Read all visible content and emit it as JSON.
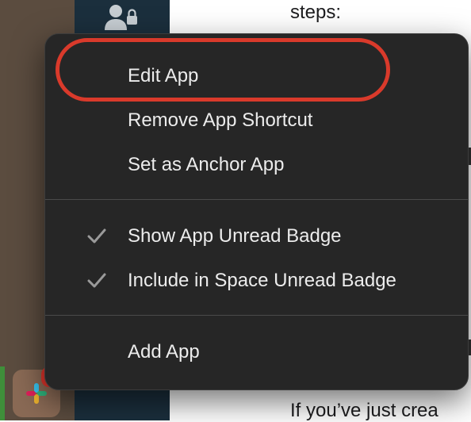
{
  "content": {
    "top_text": "steps:",
    "bottom_text": "If you’ve just crea"
  },
  "menu": {
    "items": [
      {
        "label": "Edit App",
        "checked": false
      },
      {
        "label": "Remove App Shortcut",
        "checked": false
      },
      {
        "label": "Set as Anchor App",
        "checked": false
      },
      {
        "label": "Show App Unread Badge",
        "checked": true
      },
      {
        "label": "Include in Space Unread Badge",
        "checked": true
      },
      {
        "label": "Add App",
        "checked": false
      }
    ]
  },
  "icons": {
    "rail": "user-lock-icon",
    "app": "slack-icon",
    "check": "checkmark-icon"
  },
  "colors": {
    "menu_bg": "#262626",
    "menu_text": "#ececec",
    "highlight": "#d93a2b",
    "rail_bg": "#1b2f3d",
    "side_bg": "#5b4c3f"
  }
}
